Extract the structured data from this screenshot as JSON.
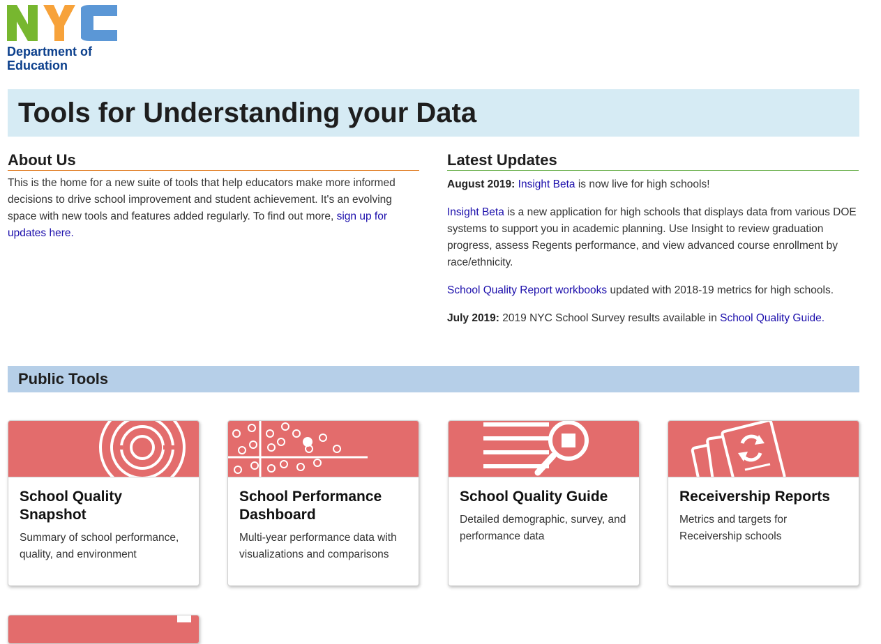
{
  "logo": {
    "letters": "NYC",
    "line1": "Department of",
    "line2": "Education",
    "colors": {
      "n": "#77b72f",
      "y": "#f7a23a",
      "c": "#5b97d6",
      "text": "#0b3f8c"
    }
  },
  "page_title": "Tools for Understanding your Data",
  "about": {
    "heading": "About Us",
    "body": "This is the home for a new suite of tools that help educators make more informed decisions to drive school improvement and student achievement. It's an evolving space with new tools and features added regularly. To find out more,",
    "link": "sign up for updates here."
  },
  "updates": {
    "heading": "Latest Updates",
    "u1_date": "August 2019:",
    "u1_link": "Insight Beta",
    "u1_text": "is now live for high schools!",
    "u2_link": "Insight Beta",
    "u2_text": "is a new application for high schools that displays data from various DOE systems to support you in academic planning. Use Insight to review graduation progress, assess Regents performance, and view advanced course enrollment by race/ethnicity.",
    "u3_link": "School Quality Report workbooks",
    "u3_text": "updated with 2018-19 metrics for high schools.",
    "u4_date": "July 2019:",
    "u4_text": "2019 NYC School Survey results available in",
    "u4_link": "School Quality Guide."
  },
  "public_tools": {
    "heading": "Public Tools",
    "cards": [
      {
        "title": "School Quality Snapshot",
        "desc": "Summary of school performance, quality, and environment"
      },
      {
        "title": "School Performance Dashboard",
        "desc": "Multi-year performance data with visualizations and comparisons"
      },
      {
        "title": "School Quality Guide",
        "desc": "Detailed demographic, survey, and performance data"
      },
      {
        "title": "Receivership Reports",
        "desc": "Metrics and targets for Receivership schools"
      }
    ]
  },
  "colors": {
    "card_banner": "#e36c6c",
    "title_band": "#d6ebf4",
    "tools_band": "#b6cfe8",
    "link": "#1a0dab"
  }
}
